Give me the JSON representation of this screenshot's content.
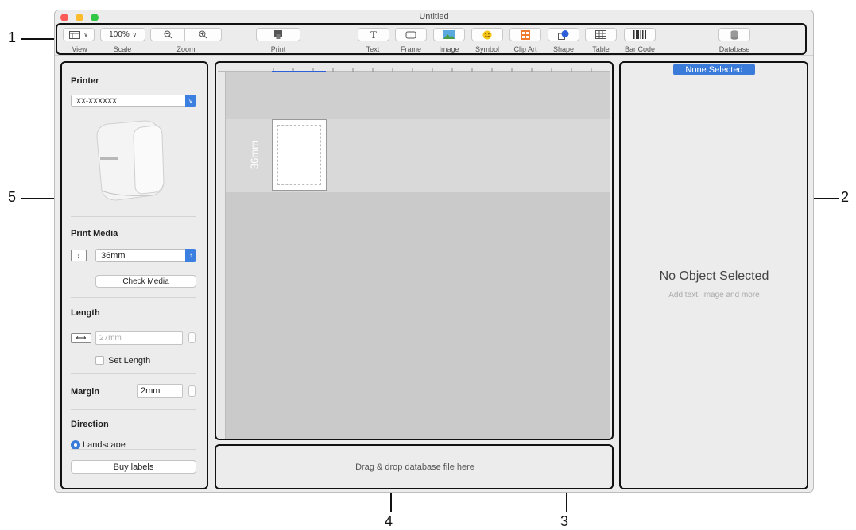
{
  "window": {
    "title": "Untitled"
  },
  "toolbar": {
    "scale_value": "100%",
    "labels": {
      "view": "View",
      "scale": "Scale",
      "zoom": "Zoom",
      "print": "Print",
      "text": "Text",
      "frame": "Frame",
      "image": "Image",
      "symbol": "Symbol",
      "clip_art": "Clip Art",
      "shape": "Shape",
      "table": "Table",
      "bar_code": "Bar Code",
      "database": "Database"
    },
    "icons": [
      "view-icon",
      "zoom-out-icon",
      "zoom-in-icon",
      "print-icon",
      "text-icon",
      "frame-icon",
      "image-icon",
      "symbol-icon",
      "clip-art-icon",
      "shape-icon",
      "table-icon",
      "barcode-icon",
      "database-icon"
    ]
  },
  "callouts": {
    "n1": "1",
    "n2": "2",
    "n3": "3",
    "n4": "4",
    "n5": "5"
  },
  "left_panel": {
    "printer_title": "Printer",
    "printer_value": "XX-XXXXXX",
    "print_media_title": "Print Media",
    "media_value": "36mm",
    "check_media": "Check Media",
    "length_title": "Length",
    "length_value": "27mm",
    "set_length": "Set Length",
    "margin_title": "Margin",
    "margin_value": "2mm",
    "direction_title": "Direction",
    "landscape": "Landscape",
    "buy_labels": "Buy labels"
  },
  "canvas": {
    "media_label": "36mm"
  },
  "dropzone": {
    "text": "Drag & drop database file here"
  },
  "right_panel": {
    "badge": "None Selected",
    "title": "No Object Selected",
    "subtitle": "Add text, image and more"
  },
  "colors": {
    "accent": "#3a7ad9",
    "close": "#fc5b57",
    "minimize": "#fdbc2e",
    "maximize": "#33c748",
    "clip_art": "#f07a2b",
    "shape": "#2d5fd8"
  }
}
